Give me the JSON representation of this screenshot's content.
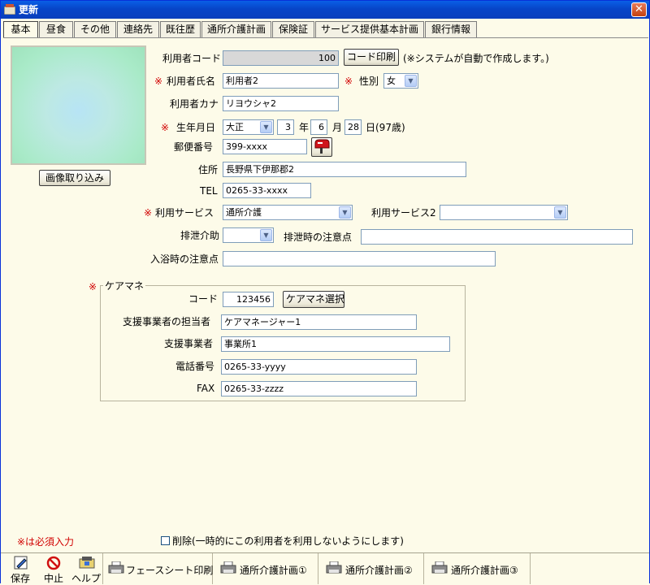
{
  "window": {
    "title": "更新",
    "close_symbol": "✕"
  },
  "tabs": [
    {
      "label": "基本",
      "active": true
    },
    {
      "label": "昼食"
    },
    {
      "label": "その他"
    },
    {
      "label": "連絡先"
    },
    {
      "label": "既往歴"
    },
    {
      "label": "通所介護計画"
    },
    {
      "label": "保険証"
    },
    {
      "label": "サービス提供基本計画"
    },
    {
      "label": "銀行情報"
    }
  ],
  "photo": {
    "import_button": "画像取り込み"
  },
  "form": {
    "user_code_label": "利用者コード",
    "user_code_value": "100",
    "code_print_button": "コード印刷",
    "code_note": "(※システムが自動で作成します。)",
    "required_mark": "※",
    "name_label": "利用者氏名",
    "name_value": "利用者2",
    "gender_label": "性別",
    "gender_value": "女",
    "kana_label": "利用者カナ",
    "kana_value": "リヨウシャ2",
    "birth_label": "生年月日",
    "era_value": "大正",
    "year_value": "3",
    "year_unit": "年",
    "month_value": "6",
    "month_unit": "月",
    "day_value": "28",
    "day_unit": "日",
    "age_text": "(97歳)",
    "zip_label": "郵便番号",
    "zip_value": "399-xxxx",
    "address_label": "住所",
    "address_value": "長野県下伊那郡2",
    "tel_label": "TEL",
    "tel_value": "0265-33-xxxx",
    "service_label": "利用サービス",
    "service_value": "通所介護",
    "service2_label": "利用サービス2",
    "service2_value": "",
    "excretion_label": "排泄介助",
    "excretion_value": "",
    "excretion_note_label": "排泄時の注意点",
    "excretion_note_value": "",
    "bath_note_label": "入浴時の注意点",
    "bath_note_value": ""
  },
  "caremanager": {
    "group_title": "ケアマネ",
    "code_label": "コード",
    "code_value": "123456",
    "select_button": "ケアマネ選択",
    "person_label": "支援事業者の担当者",
    "person_value": "ケアマネージャー1",
    "office_label": "支援事業者",
    "office_value": "事業所1",
    "phone_label": "電話番号",
    "phone_value": "0265-33-yyyy",
    "fax_label": "FAX",
    "fax_value": "0265-33-zzzz"
  },
  "footer": {
    "required_note": "※は必須入力",
    "delete_label": "削除(一時的にこの利用者を利用しないようにします)"
  },
  "toolbar": {
    "save": "保存",
    "cancel": "中止",
    "help": "ヘルプ",
    "face_sheet": "フェースシート印刷",
    "plan1": "通所介護計画①",
    "plan2": "通所介護計画②",
    "plan3": "通所介護計画③"
  }
}
